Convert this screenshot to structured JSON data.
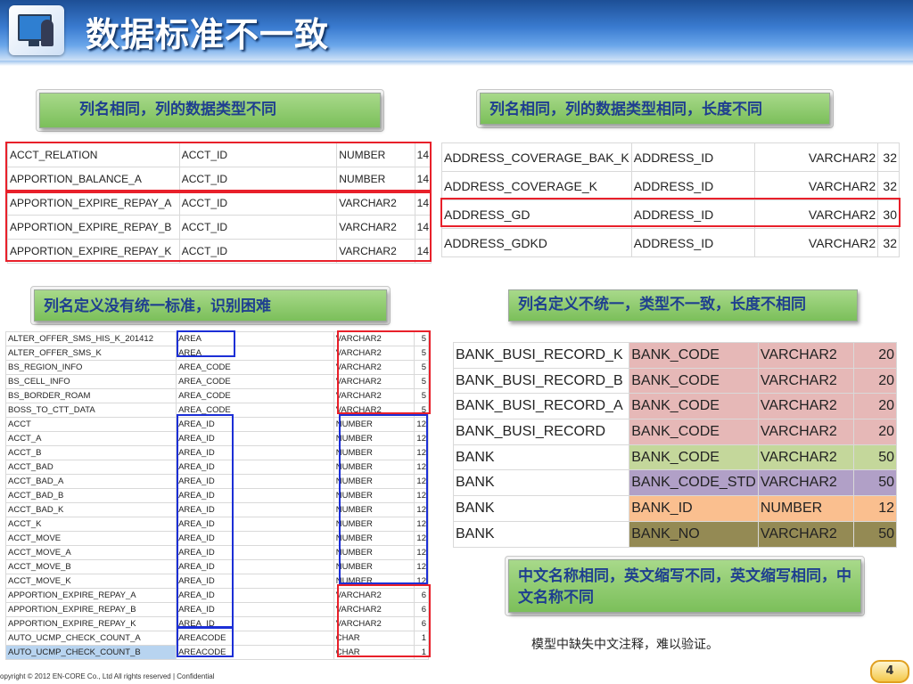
{
  "title": "数据标准不一致",
  "labels": {
    "l1": "列名相同，列的数据类型不同",
    "l2": "列名相同，列的数据类型相同，长度不同",
    "l3": "列名定义没有统一标准，识别困难",
    "l4": "列名定义不统一，类型不一致，长度不相同",
    "l5": "中文名称相同，英文缩写不同，英文缩写相同，中文名称不同"
  },
  "table1": [
    [
      "ACCT_RELATION",
      "ACCT_ID",
      "NUMBER",
      "14"
    ],
    [
      "APPORTION_BALANCE_A",
      "ACCT_ID",
      "NUMBER",
      "14"
    ],
    [
      "APPORTION_EXPIRE_REPAY_A",
      "ACCT_ID",
      "VARCHAR2",
      "14"
    ],
    [
      "APPORTION_EXPIRE_REPAY_B",
      "ACCT_ID",
      "VARCHAR2",
      "14"
    ],
    [
      "APPORTION_EXPIRE_REPAY_K",
      "ACCT_ID",
      "VARCHAR2",
      "14"
    ]
  ],
  "table2": [
    [
      "ADDRESS_COVERAGE_BAK_K",
      "ADDRESS_ID",
      "VARCHAR2",
      "32"
    ],
    [
      "ADDRESS_COVERAGE_K",
      "ADDRESS_ID",
      "VARCHAR2",
      "32"
    ],
    [
      "ADDRESS_GD",
      "ADDRESS_ID",
      "VARCHAR2",
      "30"
    ],
    [
      "ADDRESS_GDKD",
      "ADDRESS_ID",
      "VARCHAR2",
      "32"
    ]
  ],
  "table3": [
    [
      "ALTER_OFFER_SMS_HIS_K_201412",
      "AREA",
      "VARCHAR2",
      "5"
    ],
    [
      "ALTER_OFFER_SMS_K",
      "AREA",
      "VARCHAR2",
      "5"
    ],
    [
      "BS_REGION_INFO",
      "AREA_CODE",
      "VARCHAR2",
      "5"
    ],
    [
      "BS_CELL_INFO",
      "AREA_CODE",
      "VARCHAR2",
      "5"
    ],
    [
      "BS_BORDER_ROAM",
      "AREA_CODE",
      "VARCHAR2",
      "5"
    ],
    [
      "BOSS_TO_CTT_DATA",
      "AREA_CODE",
      "VARCHAR2",
      "5"
    ],
    [
      "ACCT",
      "AREA_ID",
      "NUMBER",
      "12"
    ],
    [
      "ACCT_A",
      "AREA_ID",
      "NUMBER",
      "12"
    ],
    [
      "ACCT_B",
      "AREA_ID",
      "NUMBER",
      "12"
    ],
    [
      "ACCT_BAD",
      "AREA_ID",
      "NUMBER",
      "12"
    ],
    [
      "ACCT_BAD_A",
      "AREA_ID",
      "NUMBER",
      "12"
    ],
    [
      "ACCT_BAD_B",
      "AREA_ID",
      "NUMBER",
      "12"
    ],
    [
      "ACCT_BAD_K",
      "AREA_ID",
      "NUMBER",
      "12"
    ],
    [
      "ACCT_K",
      "AREA_ID",
      "NUMBER",
      "12"
    ],
    [
      "ACCT_MOVE",
      "AREA_ID",
      "NUMBER",
      "12"
    ],
    [
      "ACCT_MOVE_A",
      "AREA_ID",
      "NUMBER",
      "12"
    ],
    [
      "ACCT_MOVE_B",
      "AREA_ID",
      "NUMBER",
      "12"
    ],
    [
      "ACCT_MOVE_K",
      "AREA_ID",
      "NUMBER",
      "12"
    ],
    [
      "APPORTION_EXPIRE_REPAY_A",
      "AREA_ID",
      "VARCHAR2",
      "6"
    ],
    [
      "APPORTION_EXPIRE_REPAY_B",
      "AREA_ID",
      "VARCHAR2",
      "6"
    ],
    [
      "APPORTION_EXPIRE_REPAY_K",
      "AREA_ID",
      "VARCHAR2",
      "6"
    ],
    [
      "AUTO_UCMP_CHECK_COUNT_A",
      "AREACODE",
      "CHAR",
      "1"
    ],
    [
      "AUTO_UCMP_CHECK_COUNT_B",
      "AREACODE",
      "CHAR",
      "1"
    ]
  ],
  "table4": [
    [
      "BANK_BUSI_RECORD_K",
      "BANK_CODE",
      "VARCHAR2",
      "20"
    ],
    [
      "BANK_BUSI_RECORD_B",
      "BANK_CODE",
      "VARCHAR2",
      "20"
    ],
    [
      "BANK_BUSI_RECORD_A",
      "BANK_CODE",
      "VARCHAR2",
      "20"
    ],
    [
      "BANK_BUSI_RECORD",
      "BANK_CODE",
      "VARCHAR2",
      "20"
    ],
    [
      "BANK",
      "BANK_CODE",
      "VARCHAR2",
      "50"
    ],
    [
      "BANK",
      "BANK_CODE_STD",
      "VARCHAR2",
      "50"
    ],
    [
      "BANK",
      "BANK_ID",
      "NUMBER",
      "12"
    ],
    [
      "BANK",
      "BANK_NO",
      "VARCHAR2",
      "50"
    ]
  ],
  "table4_colors": [
    "#e6b8b7",
    "#e6b8b7",
    "#e6b8b7",
    "#e6b8b7",
    "#c4d79b",
    "#b1a0c7",
    "#fabf8f",
    "#948a54"
  ],
  "note": "模型中缺失中文注释，难以验证。",
  "footer": "opyright © 2012 EN-CORE Co., Ltd  All rights reserved  |  Confidential",
  "page": "4"
}
